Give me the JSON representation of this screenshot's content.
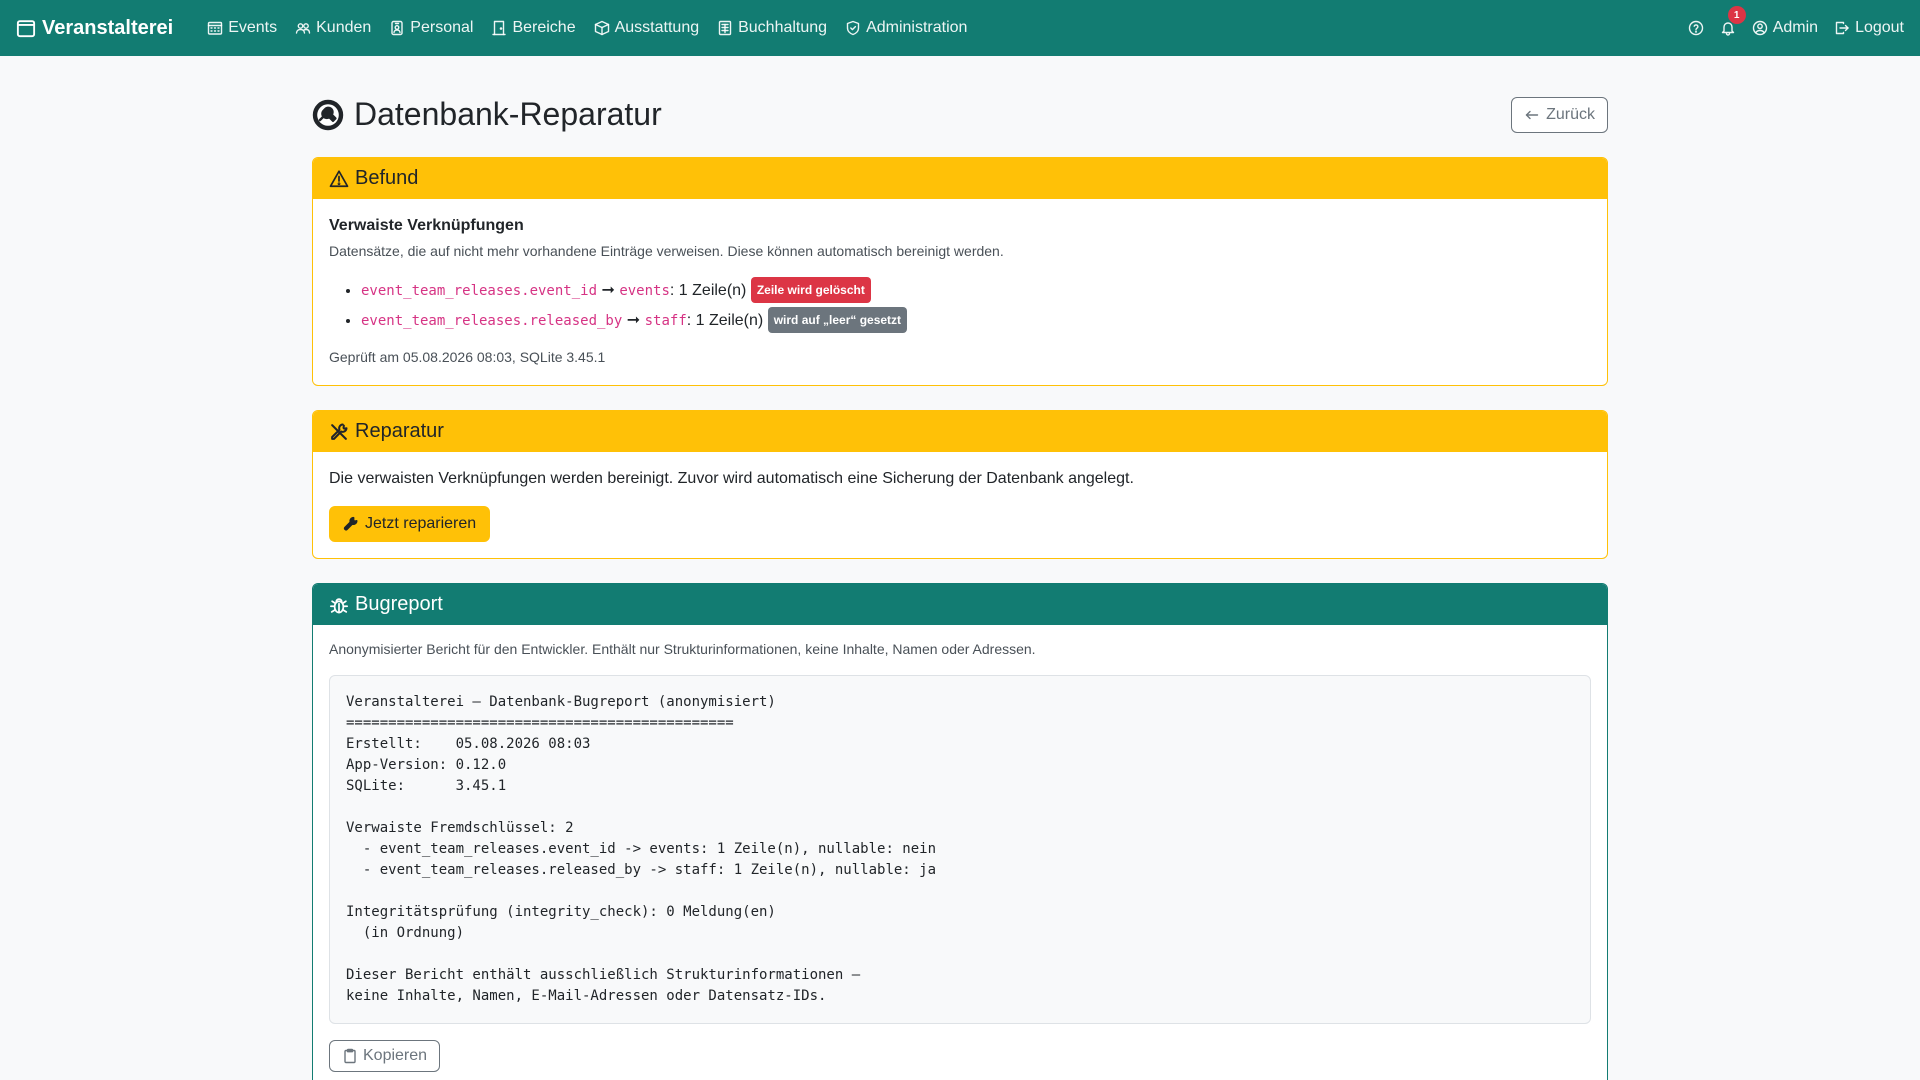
{
  "nav": {
    "brand": "Veranstalterei",
    "links": [
      {
        "label": "Events",
        "icon": "calendar-grid-icon"
      },
      {
        "label": "Kunden",
        "icon": "people-icon"
      },
      {
        "label": "Personal",
        "icon": "person-badge-icon"
      },
      {
        "label": "Bereiche",
        "icon": "door-icon"
      },
      {
        "label": "Ausstattung",
        "icon": "box-icon"
      },
      {
        "label": "Buchhaltung",
        "icon": "ledger-icon"
      },
      {
        "label": "Administration",
        "icon": "shield-icon"
      }
    ],
    "notification_count": "1",
    "user": "Admin",
    "logout": "Logout"
  },
  "page": {
    "title": "Datenbank-Reparatur",
    "back_label": "Zurück"
  },
  "befund": {
    "header": "Befund",
    "subtitle": "Verwaiste Verknüpfungen",
    "description": "Datensätze, die auf nicht mehr vorhandene Einträge verweisen. Diese können automatisch bereinigt werden.",
    "items": [
      {
        "column": "event_team_releases.event_id",
        "arrow": "➞",
        "target": "events",
        "rows": ": 1 Zeile(n)",
        "badge": "Zeile wird gelöscht"
      },
      {
        "column": "event_team_releases.released_by",
        "arrow": "➞",
        "target": "staff",
        "rows": ": 1 Zeile(n)",
        "badge": "wird auf „leer“ gesetzt"
      }
    ],
    "checked": "Geprüft am 05.08.2026 08:03, SQLite 3.45.1"
  },
  "reparatur": {
    "header": "Reparatur",
    "text": "Die verwaisten Verknüpfungen werden bereinigt. Zuvor wird automatisch eine Sicherung der Datenbank angelegt.",
    "button": "Jetzt reparieren"
  },
  "bugreport": {
    "header": "Bugreport",
    "description": "Anonymisierter Bericht für den Entwickler. Enthält nur Strukturinformationen, keine Inhalte, Namen oder Adressen.",
    "report": "Veranstalterei – Datenbank-Bugreport (anonymisiert)\n==============================================\nErstellt:    05.08.2026 08:03\nApp-Version: 0.12.0\nSQLite:      3.45.1\n\nVerwaiste Fremdschlüssel: 2\n  - event_team_releases.event_id -> events: 1 Zeile(n), nullable: nein\n  - event_team_releases.released_by -> staff: 1 Zeile(n), nullable: ja\n\nIntegritätsprüfung (integrity_check): 0 Meldung(en)\n  (in Ordnung)\n\nDieser Bericht enthält ausschließlich Strukturinformationen –\nkeine Inhalte, Namen, E-Mail-Adressen oder Datensatz-IDs.",
    "copy_label": "Kopieren"
  },
  "colors": {
    "primary": "#127c72",
    "warning": "#ffc107",
    "danger": "#dc3545",
    "secondary": "#6c757d"
  }
}
